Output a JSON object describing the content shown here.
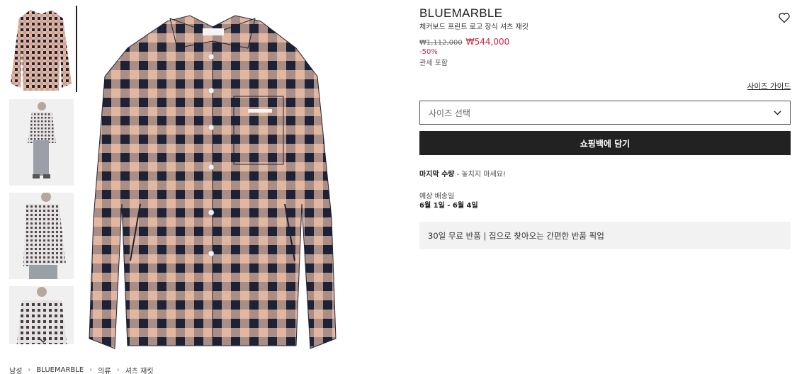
{
  "product": {
    "brand": "BLUEMARBLE",
    "name": "체커보드 프린트 로고 장식 셔츠 재킷",
    "original_price": "₩1,112,000",
    "sale_price": "₩544,000",
    "discount": "-50%",
    "duty_note": "관세 포함"
  },
  "size_guide": "사이즈 가이드",
  "size_select": {
    "placeholder": "사이즈 선택"
  },
  "add_to_bag": "쇼핑백에 담기",
  "stock": {
    "label": "마지막 수량",
    "message": "- 놓치지 마세요!"
  },
  "shipping": {
    "label": "예상 배송일",
    "dates": "6월 1일 - 6월 4일"
  },
  "returns_note": "30일 무료 반품 | 집으로 찾아오는 간편한 반품 픽업",
  "breadcrumb": [
    "남성",
    "BLUEMARBLE",
    "의류",
    "셔츠 재킷"
  ],
  "gallery": {
    "thumbnail_count": 4,
    "selected_index": 0
  },
  "colors": {
    "accent_sale": "#d0263e",
    "button_bg": "#222222",
    "check_light": "#e2b7a2",
    "check_dark": "#1d2237"
  }
}
